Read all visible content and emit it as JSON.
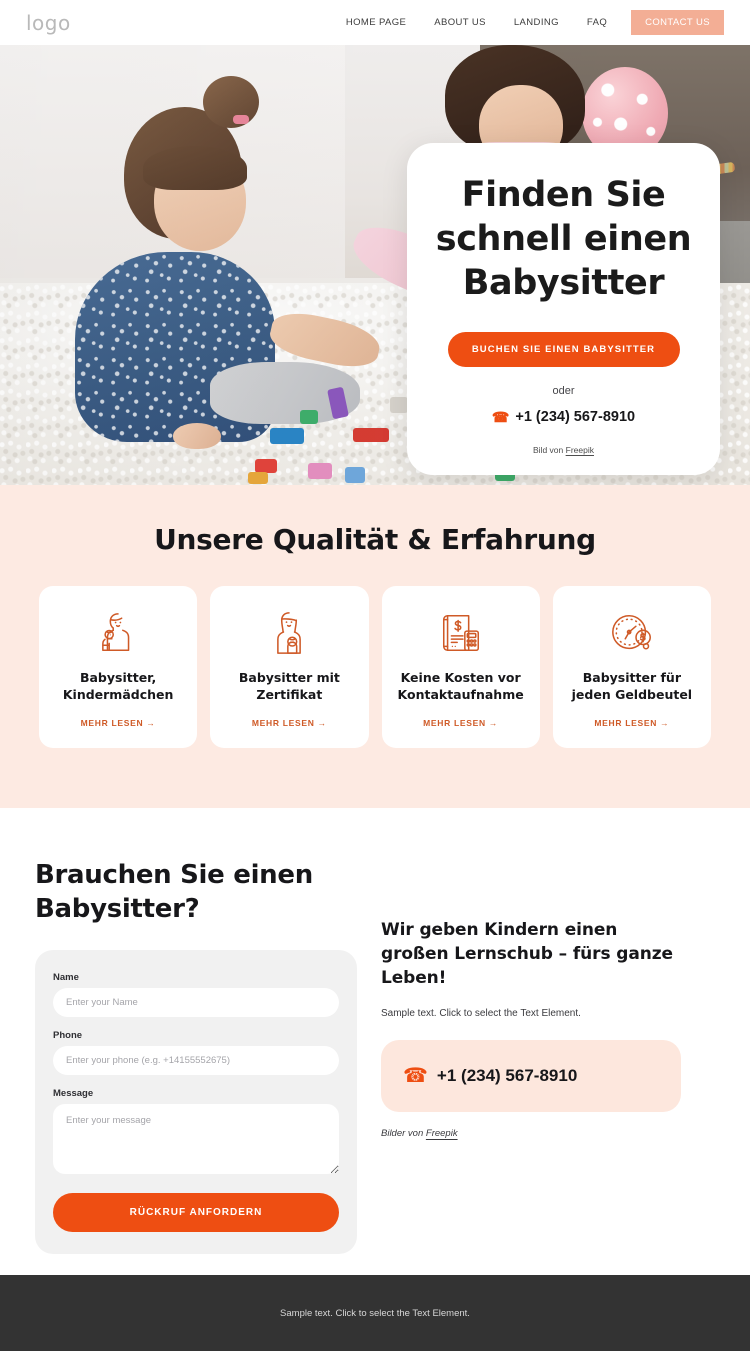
{
  "header": {
    "logo": "logo",
    "nav": [
      {
        "label": "HOME PAGE"
      },
      {
        "label": "ABOUT US"
      },
      {
        "label": "LANDING"
      },
      {
        "label": "FAQ"
      }
    ],
    "cta": "CONTACT US",
    "cta_color": "#f3ae95"
  },
  "hero": {
    "title": "Finden Sie schnell einen Babysitter",
    "button": "BUCHEN SIE EINEN BABYSITTER",
    "or": "oder",
    "phone": "+1 (234) 567-8910",
    "phone_icon": "phone-icon",
    "credit_prefix": "Bild von ",
    "credit_link": "Freepik",
    "accent_color": "#ee4e12"
  },
  "features": {
    "title": "Unsere Qualität & Erfahrung",
    "background": "#fdeae2",
    "cards": [
      {
        "icon": "nanny-with-baby-icon",
        "title": "Babysitter, Kindermädchen",
        "link": "MEHR LESEN"
      },
      {
        "icon": "woman-holding-baby-icon",
        "title": "Babysitter mit Zertifikat",
        "link": "MEHR LESEN"
      },
      {
        "icon": "invoice-calculator-icon",
        "title": "Keine Kosten vor Kontaktaufnahme",
        "link": "MEHR LESEN"
      },
      {
        "icon": "clock-money-icon",
        "title": "Babysitter für jeden Geldbeutel",
        "link": "MEHR LESEN"
      }
    ],
    "link_color": "#cf5a27"
  },
  "contact": {
    "heading": "Brauchen Sie einen Babysitter?",
    "form": {
      "name_label": "Name",
      "name_placeholder": "Enter your Name",
      "name_value": "",
      "phone_label": "Phone",
      "phone_placeholder": "Enter your phone (e.g. +14155552675)",
      "phone_value": "",
      "message_label": "Message",
      "message_placeholder": "Enter your message",
      "message_value": "",
      "submit": "RÜCKRUF ANFORDERN"
    },
    "right": {
      "heading": "Wir geben Kindern einen großen Lernschub – fürs ganze Leben!",
      "text": "Sample text. Click to select the Text Element.",
      "phone_icon": "phone-icon",
      "phone": "+1 (234) 567-8910",
      "phone_box_color": "#fde7dd",
      "credit_prefix": "Bilder von ",
      "credit_link": "Freepik"
    }
  },
  "footer": {
    "text": "Sample text. Click to select the Text Element.",
    "background": "#333333"
  }
}
